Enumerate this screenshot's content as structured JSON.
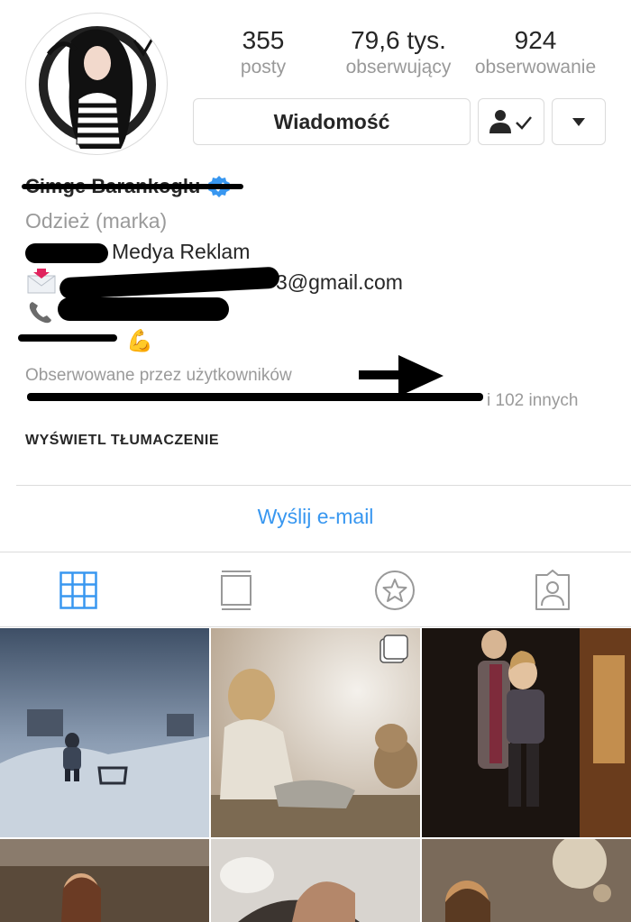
{
  "profile": {
    "name": "Cimge Barankoglu",
    "category": "Odzież (marka)",
    "bio_company": "Medya Reklam",
    "bio_email": "3@gmail.com",
    "bio_phone": "",
    "bio_location_emoji": "💪",
    "followed_by_prefix": "Obserwowane przez użytkowników",
    "followed_by_suffix": "i 102 innych",
    "translate_label": "WYŚWIETL TŁUMACZENIE"
  },
  "stats": [
    {
      "value": "355",
      "label": "posty"
    },
    {
      "value": "79,6 tys.",
      "label": "obserwujący"
    },
    {
      "value": "924",
      "label": "obserwowanie"
    }
  ],
  "actions": {
    "message_label": "Wiadomość",
    "email_label": "Wyślij e-mail"
  },
  "tabs": [
    {
      "icon": "grid-icon",
      "active": true
    },
    {
      "icon": "feed-icon",
      "active": false
    },
    {
      "icon": "star-icon",
      "active": false
    },
    {
      "icon": "tagged-icon",
      "active": false
    }
  ],
  "colors": {
    "link": "#3897f0",
    "verified": "#3897f0",
    "muted": "#9a9a9a",
    "border": "#dbdbdb"
  }
}
